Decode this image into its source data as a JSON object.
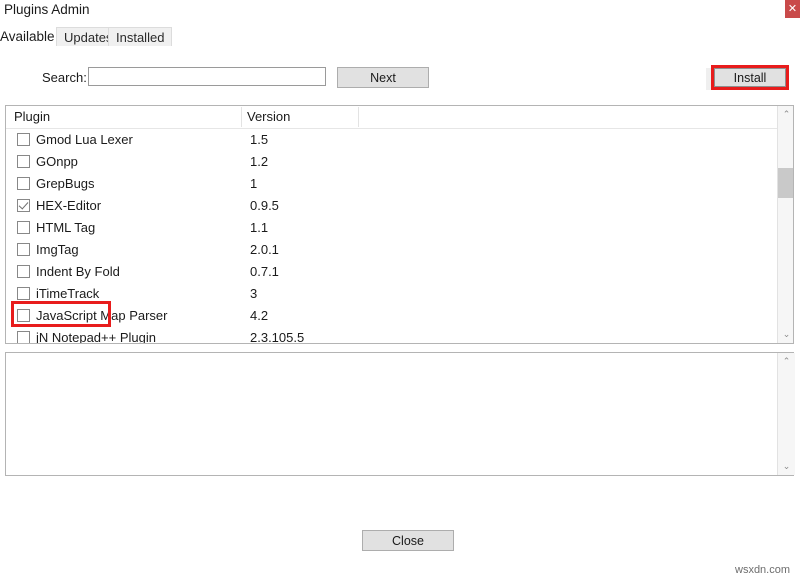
{
  "window": {
    "title": "Plugins Admin",
    "close_icon": "close-x-icon",
    "close_glyph": "✕",
    "close_color": "#c94a4a"
  },
  "tabs": [
    {
      "label": "Available",
      "active": true
    },
    {
      "label": "Updates",
      "active": false
    },
    {
      "label": "Installed",
      "active": false
    }
  ],
  "search": {
    "label": "Search:",
    "value": "",
    "placeholder": "",
    "next_label": "Next"
  },
  "actions": {
    "install_label": "Install",
    "close_label": "Close",
    "highlight_color": "#e81c1c"
  },
  "table": {
    "columns": [
      "Plugin",
      "Version"
    ],
    "rows": [
      {
        "name": "Gmod Lua Lexer",
        "version": "1.5",
        "checked": false,
        "highlighted": false
      },
      {
        "name": "GOnpp",
        "version": "1.2",
        "checked": false,
        "highlighted": false
      },
      {
        "name": "GrepBugs",
        "version": "1",
        "checked": false,
        "highlighted": false
      },
      {
        "name": "HEX-Editor",
        "version": "0.9.5",
        "checked": true,
        "highlighted": true
      },
      {
        "name": "HTML Tag",
        "version": "1.1",
        "checked": false,
        "highlighted": false
      },
      {
        "name": "ImgTag",
        "version": "2.0.1",
        "checked": false,
        "highlighted": false
      },
      {
        "name": "Indent By Fold",
        "version": "0.7.1",
        "checked": false,
        "highlighted": false
      },
      {
        "name": "iTimeTrack",
        "version": "3",
        "checked": false,
        "highlighted": false
      },
      {
        "name": "JavaScript Map Parser",
        "version": "4.2",
        "checked": false,
        "highlighted": false
      },
      {
        "name": "jN Notepad++ Plugin",
        "version": "2.3.105.5",
        "checked": false,
        "highlighted": false
      }
    ]
  },
  "scrollbars": {
    "up_glyph": "⌃",
    "down_glyph": "⌄"
  },
  "description": {
    "text": ""
  },
  "watermark": {
    "text": "wsxdn.com"
  }
}
